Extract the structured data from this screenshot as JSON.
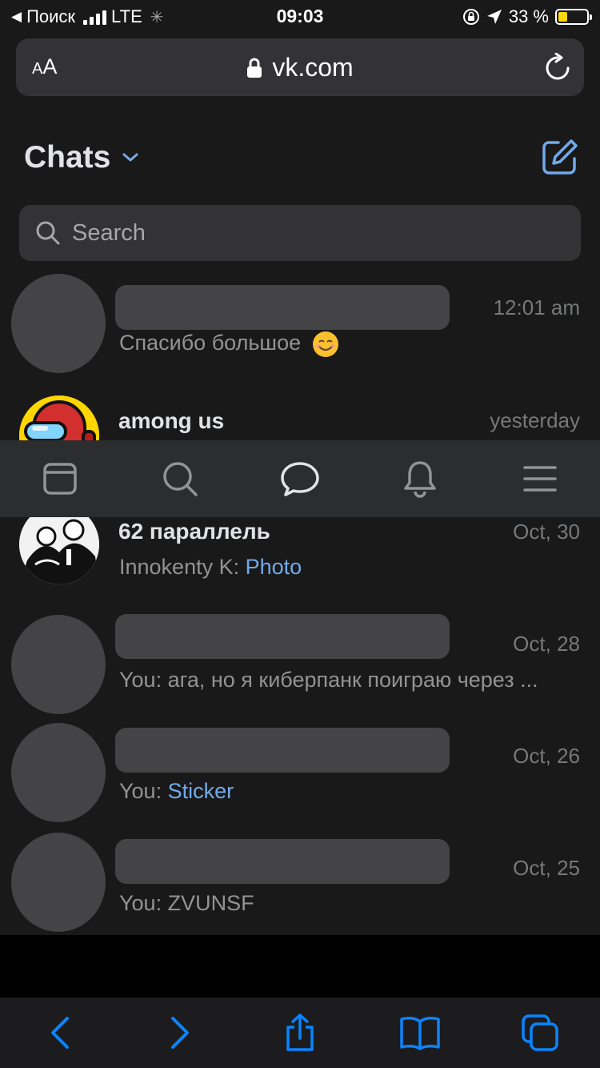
{
  "status_bar": {
    "back_label": "Поиск",
    "network": "LTE",
    "time": "09:03",
    "battery_text": "33 %",
    "battery_level": 0.33,
    "battery_color": "#ffd60a"
  },
  "url_bar": {
    "text_size_label": "AA",
    "domain": "vk.com"
  },
  "header": {
    "title": "Chats",
    "accent_color": "#71aaeb"
  },
  "search": {
    "placeholder": "Search"
  },
  "chats": [
    {
      "name": "",
      "time": "12:01 am",
      "message": "Спасибо большое",
      "emoji": "smiling-face"
    },
    {
      "name": "among us",
      "time": "yesterday",
      "message": ""
    },
    {
      "name": "62 параллель",
      "time": "Oct, 30",
      "sender": "Innokenty K:",
      "attachment": "Photo"
    },
    {
      "name": "",
      "time": "Oct, 28",
      "message": "You: ага, но я киберпанк поиграю через ..."
    },
    {
      "name": "",
      "time": "Oct, 26",
      "sender": "You:",
      "attachment": "Sticker"
    },
    {
      "name": "",
      "time": "Oct, 25",
      "message": "You: ZVUNSF"
    }
  ],
  "vk_tabbar": {
    "tabs": [
      "browse-icon",
      "search-icon",
      "messages-icon",
      "notifications-icon",
      "menu-icon"
    ],
    "active_tab": "messages-icon"
  },
  "safari_toolbar": {
    "buttons": [
      "back-icon",
      "forward-icon",
      "share-icon",
      "bookmarks-icon",
      "tabs-icon"
    ]
  }
}
